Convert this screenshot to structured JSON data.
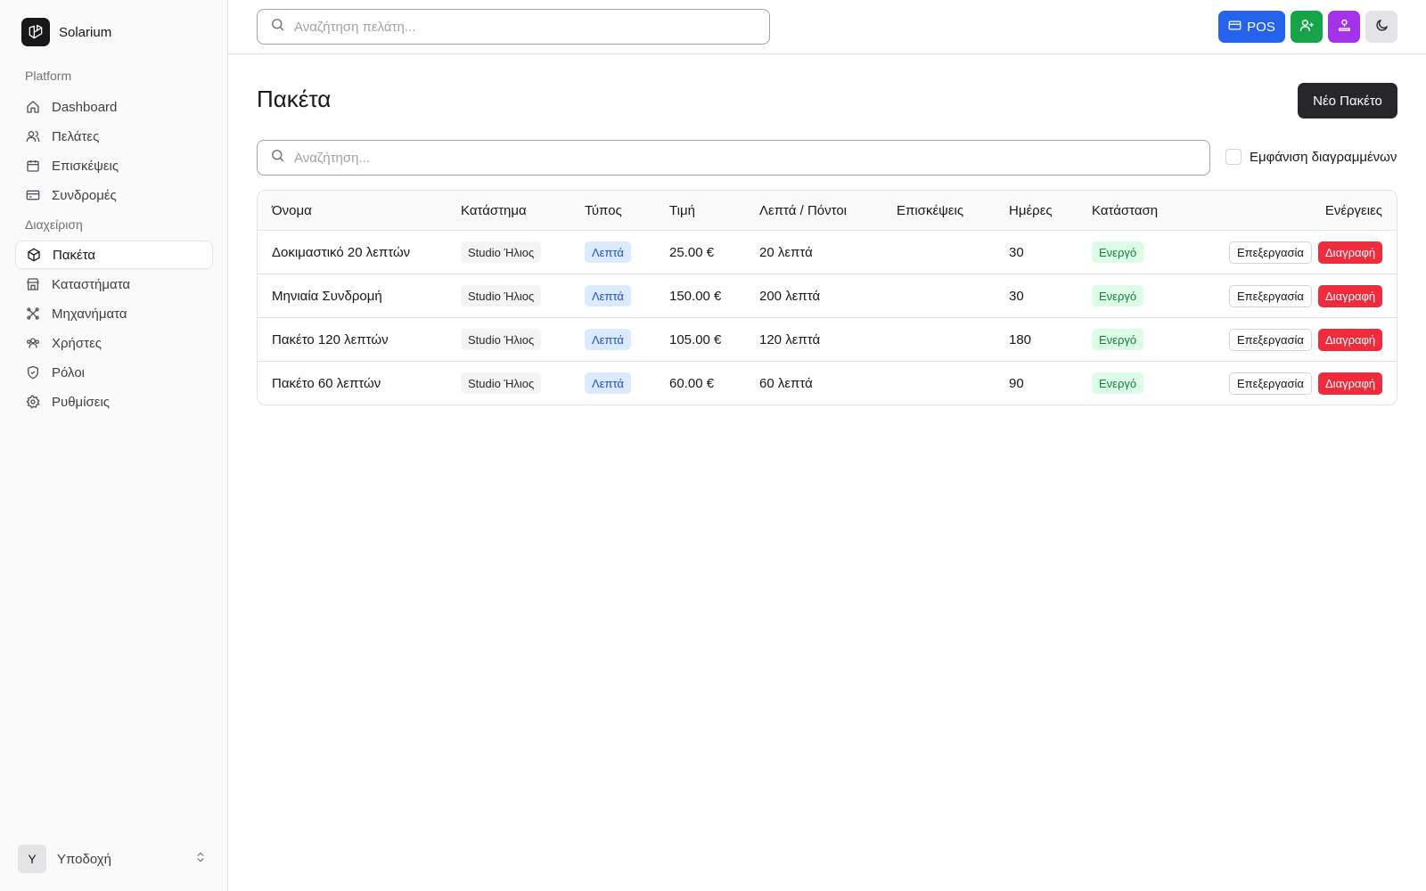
{
  "app": {
    "name": "Solarium"
  },
  "sidebar": {
    "group_platform": "Platform",
    "group_admin": "Διαχείριση",
    "platform_items": [
      {
        "label": "Dashboard",
        "icon": "home-icon"
      },
      {
        "label": "Πελάτες",
        "icon": "users-icon"
      },
      {
        "label": "Επισκέψεις",
        "icon": "calendar-icon"
      },
      {
        "label": "Συνδρομές",
        "icon": "credit-card-icon"
      }
    ],
    "admin_items": [
      {
        "label": "Πακέτα",
        "icon": "package-icon",
        "active": true
      },
      {
        "label": "Καταστήματα",
        "icon": "store-icon"
      },
      {
        "label": "Μηχανήματα",
        "icon": "machine-icon"
      },
      {
        "label": "Χρήστες",
        "icon": "user-group-icon"
      },
      {
        "label": "Ρόλοι",
        "icon": "shield-icon"
      },
      {
        "label": "Ρυθμίσεις",
        "icon": "gear-icon"
      }
    ],
    "user": {
      "initial": "Y",
      "name": "Υποδοχή"
    }
  },
  "header": {
    "search_placeholder": "Αναζήτηση πελάτη...",
    "pos_label": "POS",
    "colors": {
      "pos": "#2563eb",
      "add_customer": "#16a34a",
      "accounts": "#a332e8",
      "theme": "#e4e4e7"
    }
  },
  "main": {
    "title": "Πακέτα",
    "new_button": "Νέο Πακέτο",
    "search_placeholder": "Αναζήτηση...",
    "show_deleted_label": "Εμφάνιση διαγραμμένων",
    "show_deleted_checked": false
  },
  "table": {
    "columns": [
      "Όνομα",
      "Κατάστημα",
      "Τύπος",
      "Τιμή",
      "Λεπτά / Πόντοι",
      "Επισκέψεις",
      "Ημέρες",
      "Κατάσταση",
      "Ενέργειες"
    ],
    "edit_label": "Επεξεργασία",
    "delete_label": "Διαγραφή",
    "rows": [
      {
        "name": "Δοκιμαστικό 20 λεπτών",
        "store": "Studio Ήλιος",
        "type": "Λεπτά",
        "price": "25.00 €",
        "minutes": "20 λεπτά",
        "visits": "",
        "days": "30",
        "status": "Ενεργό"
      },
      {
        "name": "Μηνιαία Συνδρομή",
        "store": "Studio Ήλιος",
        "type": "Λεπτά",
        "price": "150.00 €",
        "minutes": "200 λεπτά",
        "visits": "",
        "days": "30",
        "status": "Ενεργό"
      },
      {
        "name": "Πακέτο 120 λεπτών",
        "store": "Studio Ήλιος",
        "type": "Λεπτά",
        "price": "105.00 €",
        "minutes": "120 λεπτά",
        "visits": "",
        "days": "180",
        "status": "Ενεργό"
      },
      {
        "name": "Πακέτο 60 λεπτών",
        "store": "Studio Ήλιος",
        "type": "Λεπτά",
        "price": "60.00 €",
        "minutes": "60 λεπτά",
        "visits": "",
        "days": "90",
        "status": "Ενεργό"
      }
    ]
  }
}
